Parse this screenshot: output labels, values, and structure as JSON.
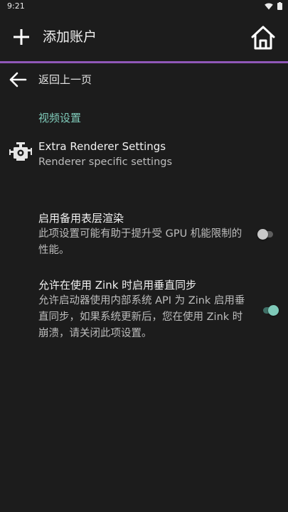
{
  "status_bar": {
    "time": "9:21"
  },
  "toolbar": {
    "add_icon": "plus-icon",
    "title": "添加账户",
    "home_icon": "home-icon"
  },
  "colors": {
    "accent_line": "#8f57b8",
    "section_title": "#7fcab9",
    "switch_on_thumb": "#7fcab9",
    "switch_on_track": "#3f6f66",
    "switch_off_thumb": "#c8c8c8",
    "switch_off_track": "#5e5e5e"
  },
  "nav": {
    "back_icon": "arrow-left-icon",
    "back_label": "返回上一页"
  },
  "section": {
    "title": "视频设置"
  },
  "preferences": [
    {
      "icon": "engine-icon",
      "title": "Extra Renderer Settings",
      "summary": "Renderer specific settings"
    },
    {
      "title": "启用备用表层渲染",
      "summary": "此项设置可能有助于提升受 GPU 机能限制的性能。",
      "switch_on": false
    },
    {
      "title": "允许在使用 Zink 时启用垂直同步",
      "summary": "允许启动器使用内部系统 API 为 Zink 启用垂直同步，如果系统更新后，您在使用 Zink 时崩溃，请关闭此项设置。",
      "switch_on": true
    }
  ]
}
